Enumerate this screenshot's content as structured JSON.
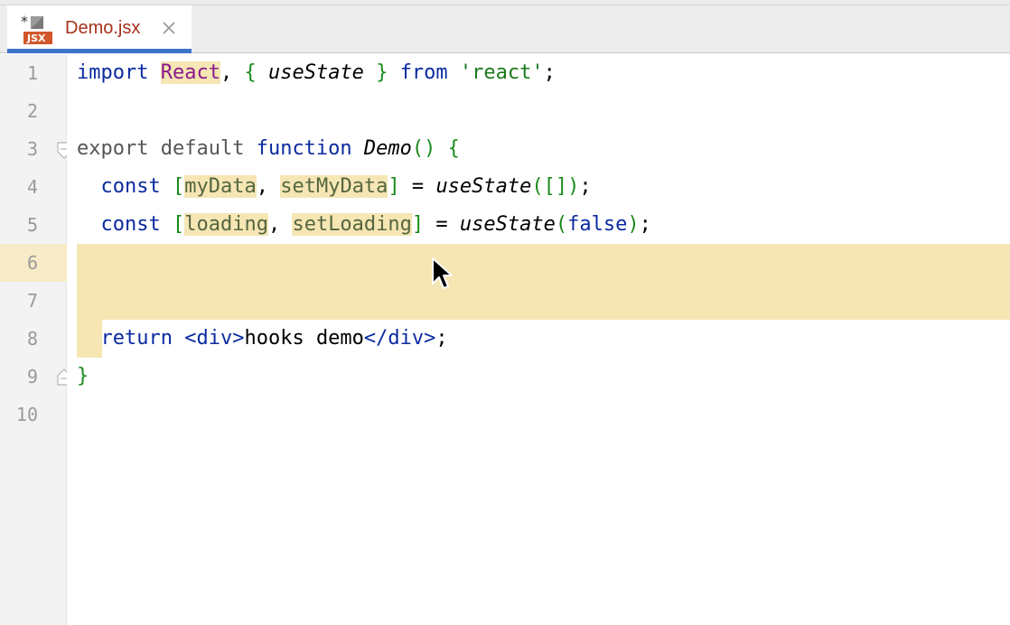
{
  "tab": {
    "label": "Demo.jsx",
    "icon_badge": "JSX",
    "modified_marker": "*"
  },
  "line_numbers": [
    "1",
    "2",
    "3",
    "4",
    "5",
    "6",
    "7",
    "8",
    "9",
    "10"
  ],
  "code": {
    "l1": {
      "import": "import",
      "sp1": " ",
      "react": "React",
      "comma": ", ",
      "lb": "{",
      "sp2": " ",
      "useState": "useState",
      "sp3": " ",
      "rb": "}",
      "sp4": " ",
      "from": "from",
      "sp5": " ",
      "str": "'react'",
      "semi": ";"
    },
    "l3": {
      "export": "export",
      "sp1": " ",
      "default": "default",
      "sp2": " ",
      "function": "function",
      "sp3": " ",
      "name": "Demo",
      "parens": "()",
      "sp4": " ",
      "lb": "{"
    },
    "l4": {
      "indent": "  ",
      "const": "const",
      "sp1": " ",
      "lbr": "[",
      "a": "myData",
      "comma": ", ",
      "b": "setMyData",
      "rbr": "]",
      "eq": " = ",
      "call": "useState",
      "args": "([])",
      "semi": ";"
    },
    "l5": {
      "indent": "  ",
      "const": "const",
      "sp1": " ",
      "lbr": "[",
      "a": "loading",
      "comma": ", ",
      "b": "setLoading",
      "rbr": "]",
      "eq": " = ",
      "call": "useState",
      "lp": "(",
      "arg": "false",
      "rp": ")",
      "semi": ";"
    },
    "l8": {
      "indent": "  ",
      "return": "return",
      "sp1": " ",
      "open": "<div>",
      "text": "hooks demo",
      "close": "</div>",
      "semi": ";"
    },
    "l9": {
      "rb": "}"
    }
  },
  "colors": {
    "keyword": "#0a2aa0",
    "highlight": "#f5e6b4",
    "tab_underline": "#3d74c8",
    "tab_text": "#a4321c"
  }
}
